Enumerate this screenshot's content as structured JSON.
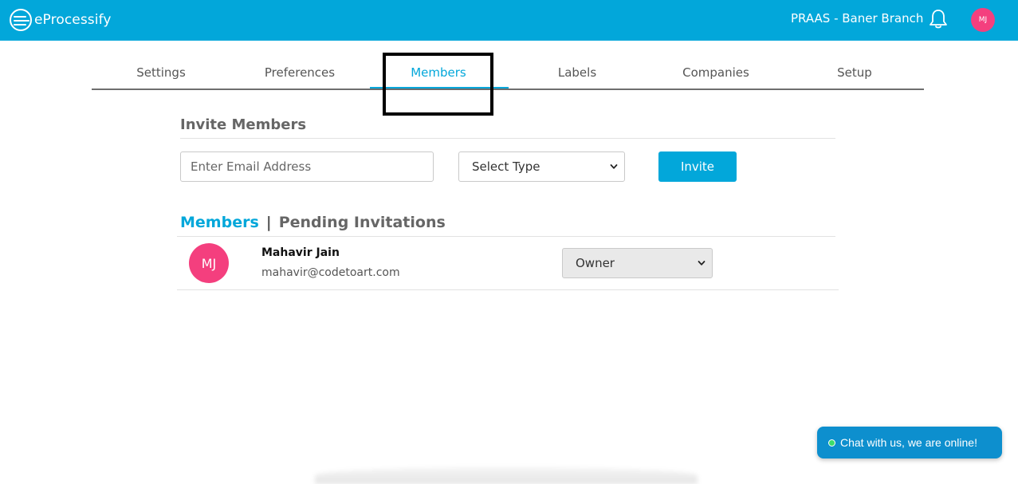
{
  "header": {
    "app_name": "eProcessify",
    "branch": "PRAAS - Baner Branch",
    "avatar_initials": "MJ",
    "brand_color": "#02a7da",
    "avatar_color": "#f43f7e"
  },
  "tabs": [
    {
      "label": "Settings",
      "active": false
    },
    {
      "label": "Preferences",
      "active": false
    },
    {
      "label": "Members",
      "active": true
    },
    {
      "label": "Labels",
      "active": false
    },
    {
      "label": "Companies",
      "active": false
    },
    {
      "label": "Setup",
      "active": false
    }
  ],
  "invite": {
    "title": "Invite Members",
    "email_placeholder": "Enter Email Address",
    "email_value": "",
    "type_selected": "Select Type",
    "invite_label": "Invite"
  },
  "members_section": {
    "members_label": "Members",
    "separator": "|",
    "pending_label": "Pending Invitations",
    "members": [
      {
        "initials": "MJ",
        "name": "Mahavir Jain",
        "email": "mahavir@codetoart.com",
        "role": "Owner"
      }
    ]
  },
  "chat": {
    "label": "Chat with us, we are online!",
    "color": "#0d8fce",
    "status_color": "#3ddc6b"
  },
  "icons": {
    "logo": "eprocessify-logo-icon",
    "notifications": "bell-icon",
    "dropdown": "chevron-down-icon",
    "online": "online-status-dot-icon"
  }
}
